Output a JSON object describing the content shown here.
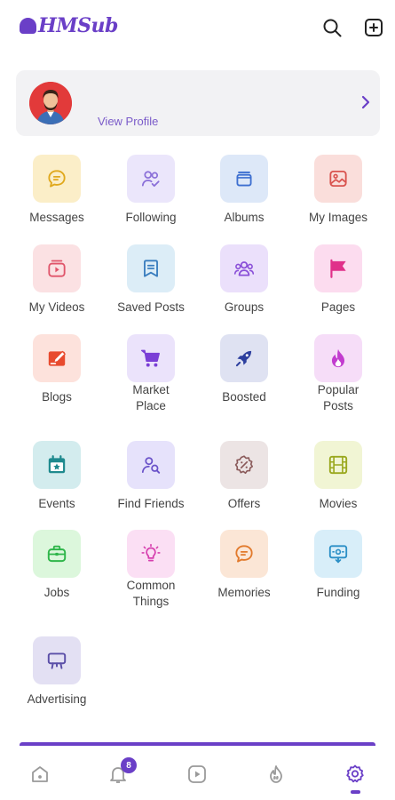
{
  "app": {
    "brand": "HMSub",
    "brand_color": "#6a3fc7"
  },
  "header": {
    "search_icon": "search-icon",
    "add_icon": "add-square-icon"
  },
  "profile": {
    "view_profile_label": "View Profile"
  },
  "menu": [
    {
      "label": "Messages",
      "icon": "chat-bubble-icon",
      "bg": "#fbeec8",
      "fg": "#e0a81c"
    },
    {
      "label": "Following",
      "icon": "users-check-icon",
      "bg": "#ebe6fb",
      "fg": "#8a6fd8"
    },
    {
      "label": "Albums",
      "icon": "album-icon",
      "bg": "#dde8f8",
      "fg": "#3d6fd0"
    },
    {
      "label": "My Images",
      "icon": "image-icon",
      "bg": "#fadedb",
      "fg": "#d9534f"
    },
    {
      "label": "My Videos",
      "icon": "video-icon",
      "bg": "#fbe1e3",
      "fg": "#e0546a"
    },
    {
      "label": "Saved Posts",
      "icon": "bookmark-icon",
      "bg": "#dcedf7",
      "fg": "#3a7ebf"
    },
    {
      "label": "Groups",
      "icon": "group-icon",
      "bg": "#ebe0fb",
      "fg": "#8a4fd8"
    },
    {
      "label": "Pages",
      "icon": "flag-icon",
      "bg": "#fcdcef",
      "fg": "#e0308a"
    },
    {
      "label": "Blogs",
      "icon": "edit-icon",
      "bg": "#fde2dc",
      "fg": "#e84a2e"
    },
    {
      "label": "Market\nPlace",
      "icon": "cart-icon",
      "bg": "#ebe3fb",
      "fg": "#7a3fd6"
    },
    {
      "label": "Boosted",
      "icon": "rocket-icon",
      "bg": "#dfe2f2",
      "fg": "#2d3f9e"
    },
    {
      "label": "Popular\nPosts",
      "icon": "fire-icon",
      "bg": "#f6ddf8",
      "fg": "#c23ccf"
    },
    {
      "label": "Events",
      "icon": "calendar-icon",
      "bg": "#d3ecee",
      "fg": "#1f8a8e"
    },
    {
      "label": "Find Friends",
      "icon": "user-search-icon",
      "bg": "#e6e2fb",
      "fg": "#6a52c9"
    },
    {
      "label": "Offers",
      "icon": "discount-icon",
      "bg": "#ece4e4",
      "fg": "#8a5a5a"
    },
    {
      "label": "Movies",
      "icon": "film-icon",
      "bg": "#f1f5d4",
      "fg": "#9aa81e"
    },
    {
      "label": "Jobs",
      "icon": "briefcase-icon",
      "bg": "#dcf7dc",
      "fg": "#2fb64a"
    },
    {
      "label": "Common\nThings",
      "icon": "lightbulb-icon",
      "bg": "#fbdff4",
      "fg": "#d63fae"
    },
    {
      "label": "Memories",
      "icon": "memory-chat-icon",
      "bg": "#fbe6d6",
      "fg": "#e27a2c"
    },
    {
      "label": "Funding",
      "icon": "funding-icon",
      "bg": "#d8eef9",
      "fg": "#2b8fc6"
    },
    {
      "label": "Advertising",
      "icon": "billboard-icon",
      "bg": "#e3e0f3",
      "fg": "#5b4fa8"
    }
  ],
  "bottom_nav": [
    {
      "icon": "home-icon"
    },
    {
      "icon": "bell-icon",
      "badge": "8"
    },
    {
      "icon": "play-icon"
    },
    {
      "icon": "hashtag-fire-icon"
    },
    {
      "icon": "settings-icon",
      "active": true
    }
  ]
}
